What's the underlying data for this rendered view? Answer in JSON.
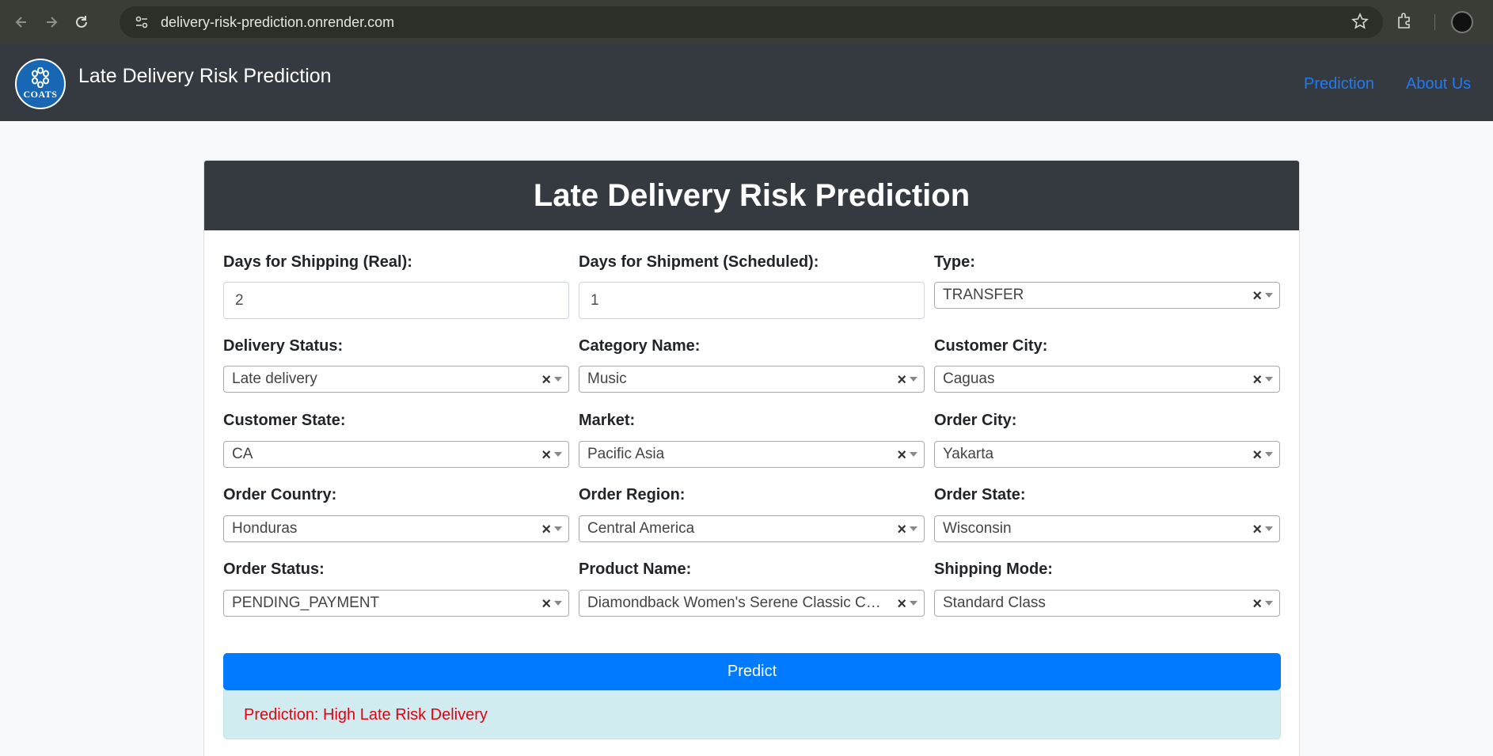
{
  "browser": {
    "url": "delivery-risk-prediction.onrender.com",
    "icons": [
      "back-arrow-icon",
      "forward-arrow-icon",
      "reload-icon",
      "site-settings-icon",
      "star-icon",
      "extensions-icon",
      "profile-avatar"
    ]
  },
  "navbar": {
    "logo_text": "COATS",
    "brand": "Late Delivery Risk Prediction",
    "links": [
      "Prediction",
      "About Us"
    ]
  },
  "card": {
    "title": "Late Delivery Risk Prediction"
  },
  "form": {
    "days_real": {
      "label": "Days for Shipping (Real):",
      "value": "2"
    },
    "days_scheduled": {
      "label": "Days for Shipment (Scheduled):",
      "value": "1"
    },
    "type": {
      "label": "Type:",
      "value": "TRANSFER"
    },
    "delivery_status": {
      "label": "Delivery Status:",
      "value": "Late delivery"
    },
    "category_name": {
      "label": "Category Name:",
      "value": "Music"
    },
    "customer_city": {
      "label": "Customer City:",
      "value": "Caguas"
    },
    "customer_state": {
      "label": "Customer State:",
      "value": "CA"
    },
    "market": {
      "label": "Market:",
      "value": "Pacific Asia"
    },
    "order_city": {
      "label": "Order City:",
      "value": "Yakarta"
    },
    "order_country": {
      "label": "Order Country:",
      "value": "Honduras"
    },
    "order_region": {
      "label": "Order Region:",
      "value": "Central America"
    },
    "order_state": {
      "label": "Order State:",
      "value": "Wisconsin"
    },
    "order_status": {
      "label": "Order Status:",
      "value": "PENDING_PAYMENT"
    },
    "product_name": {
      "label": "Product Name:",
      "value": "Diamondback Women's Serene Classic Co..."
    },
    "shipping_mode": {
      "label": "Shipping Mode:",
      "value": "Standard Class"
    },
    "clear_symbol": "×"
  },
  "predict_button": "Predict",
  "result": "Prediction: High Late Risk Delivery",
  "colors": {
    "navbar_bg": "#343a40",
    "primary": "#007bff",
    "result_bg": "#d1ecf1",
    "result_text": "#e3000f"
  }
}
